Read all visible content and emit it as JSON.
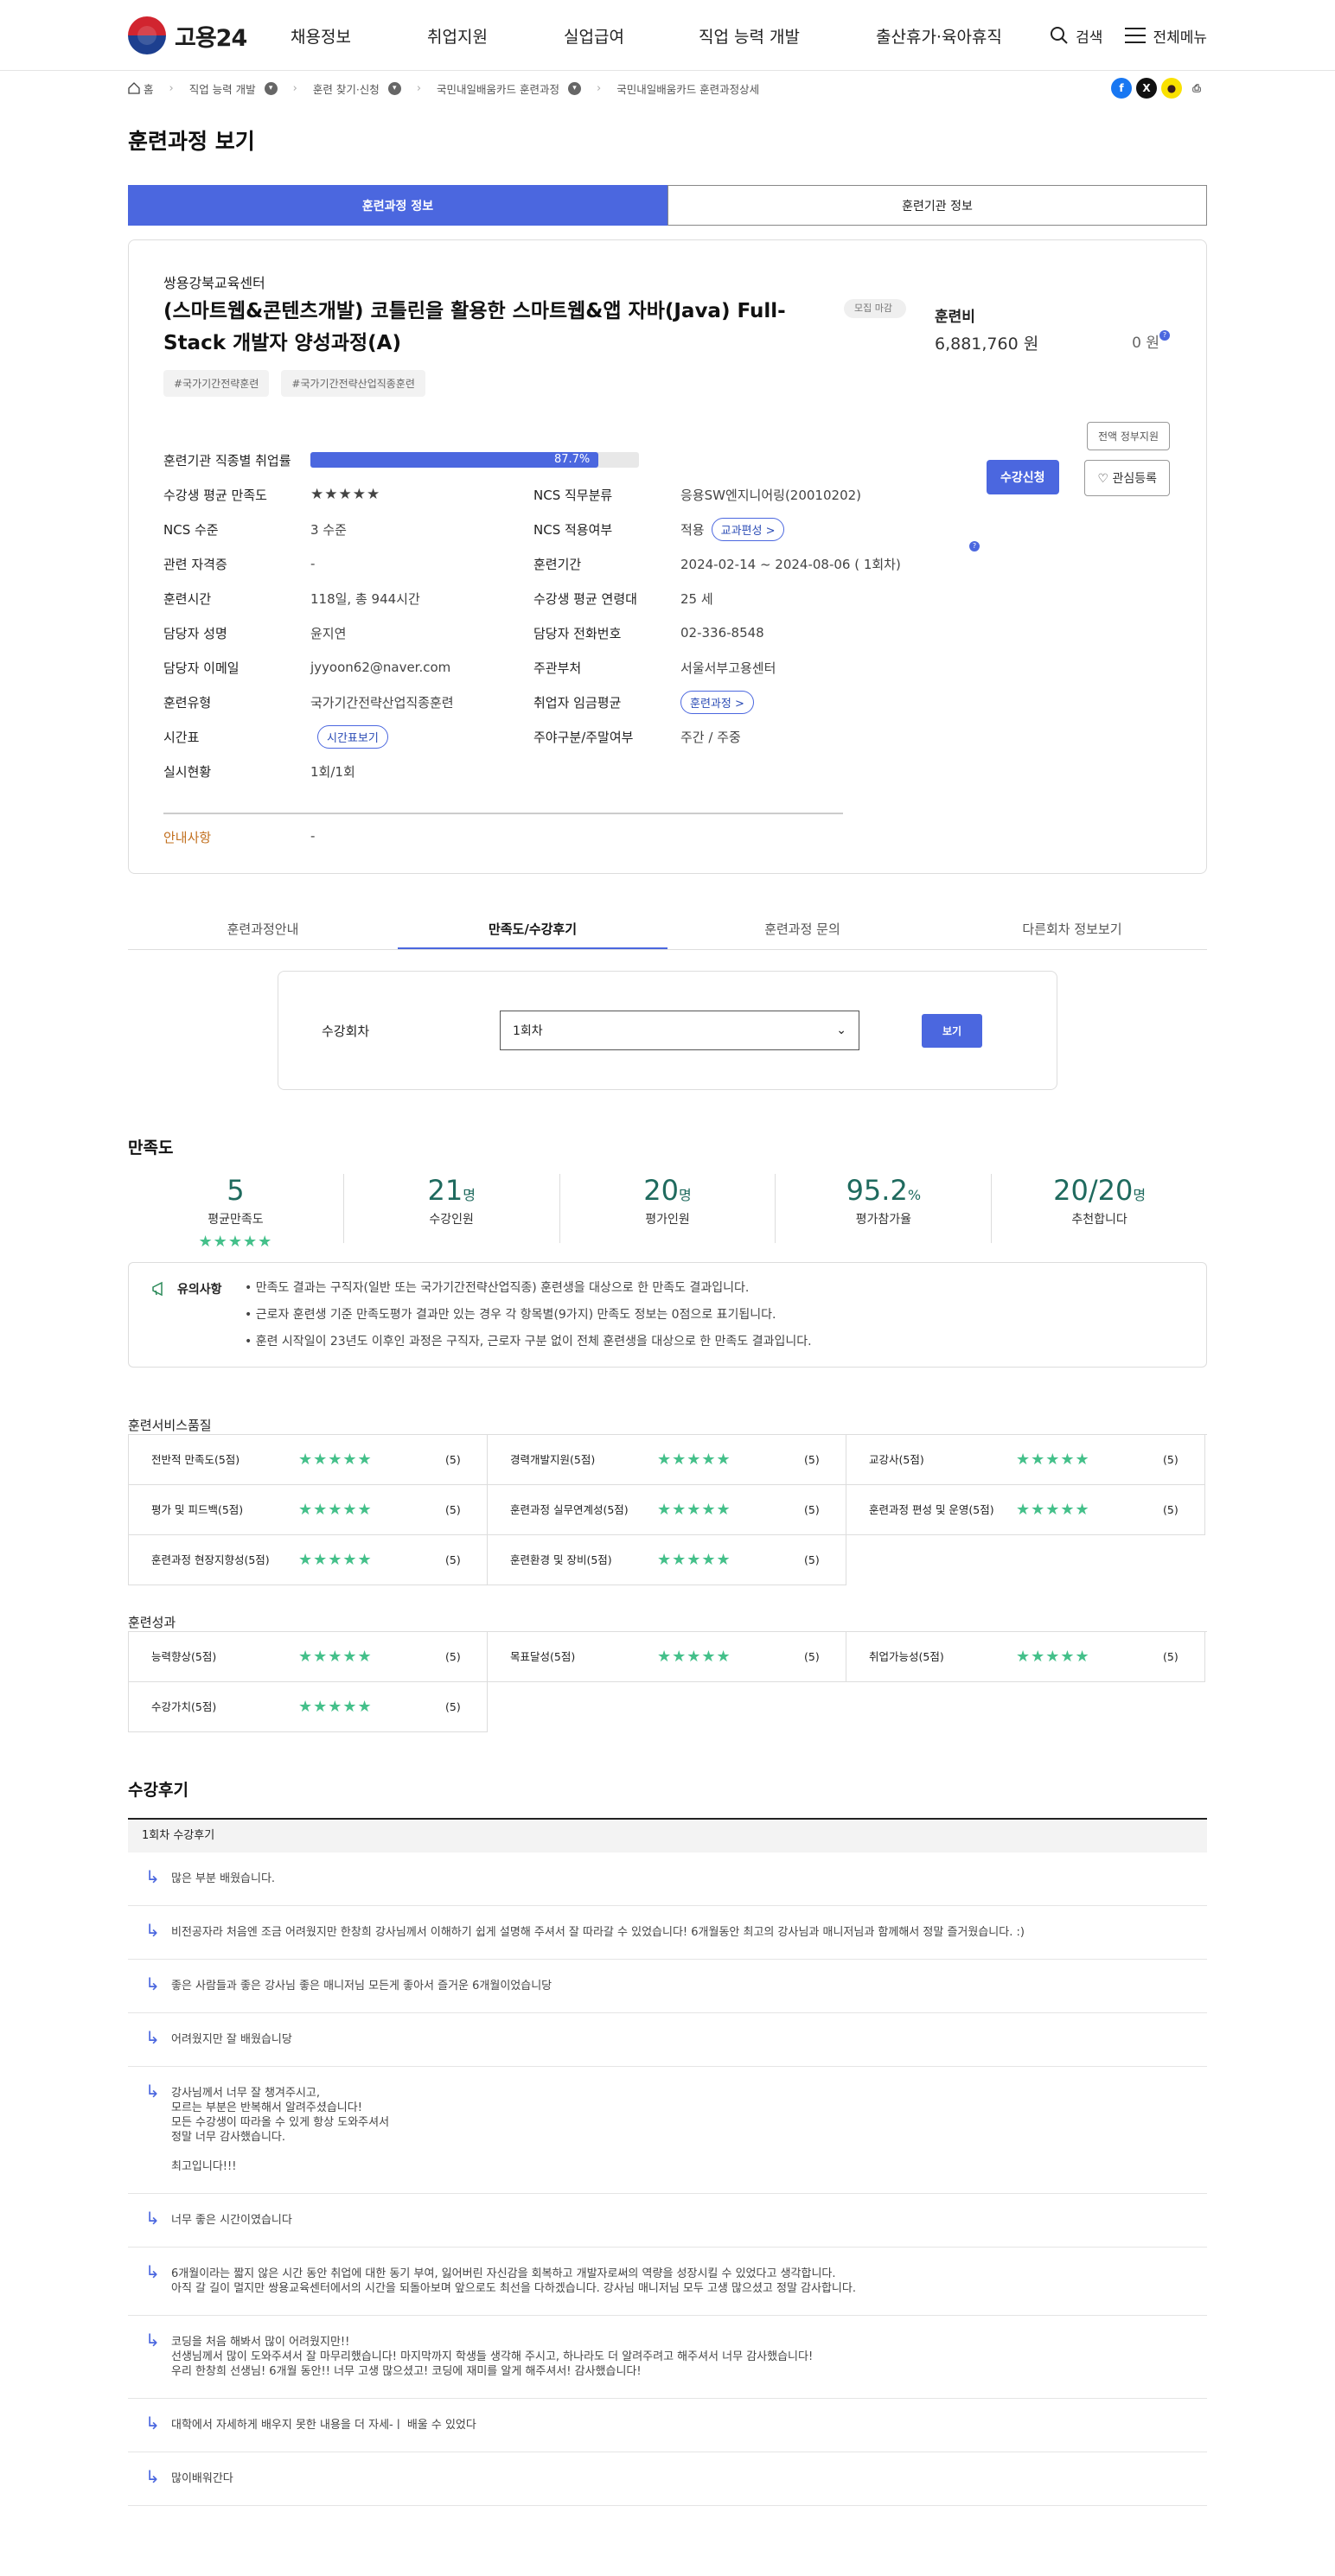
{
  "header": {
    "logo": "고용24",
    "menu": [
      "채용정보",
      "취업지원",
      "실업급여",
      "직업 능력 개발",
      "출산휴가·육아휴직"
    ],
    "search": "검색",
    "all_menu": "전체메뉴"
  },
  "breadcrumb": [
    "홈",
    "직업 능력 개발",
    "훈련 찾기·신청",
    "국민내일배움카드 훈련과정",
    "국민내일배움카드 훈련과정상세"
  ],
  "page_title": "훈련과정 보기",
  "main_tabs": [
    "훈련과정 정보",
    "훈련기관 정보"
  ],
  "course": {
    "org": "쌍용강북교육센터",
    "title": "(스마트웹&콘텐츠개발) 코틀린을 활용한 스마트웹&앱 자바(Java) Full-Stack 개발자 양성과정(A)",
    "status": "모집 마감",
    "tags": [
      "#국가기간전략훈련",
      "#국가기간전략산업직종훈련"
    ],
    "fee_label": "훈련비",
    "fee": "6,881,760 원",
    "self_pay": "0 원",
    "gov_support": "전액 정부지원",
    "apply": "수강신청",
    "favorite": "♡ 관심등록",
    "employ_label": "훈련기관 직종별 취업률",
    "employ_rate_text": "87.7%",
    "employ_rate": 87.7,
    "rows": [
      {
        "k": "수강생 평균 만족도",
        "v": "★★★★★",
        "k2": "NCS 직무분류",
        "v2": "응용SW엔지니어링(20010202)"
      },
      {
        "k": "NCS 수준",
        "v": "3 수준",
        "k2": "NCS 적용여부",
        "v2": "적용",
        "pill2": "교과편성 >"
      },
      {
        "k": "관련 자격증",
        "v": "-",
        "k2": "훈련기간",
        "v2": "2024-02-14 ~ 2024-08-06 ( 1회차)"
      },
      {
        "k": "훈련시간",
        "v": "118일, 총 944시간",
        "k2": "수강생 평균 연령대",
        "v2": "25 세"
      },
      {
        "k": "담당자 성명",
        "v": "윤지연",
        "k2": "담당자 전화번호",
        "v2": "02-336-8548"
      },
      {
        "k": "담당자 이메일",
        "v": "jyyoon62@naver.com",
        "k2": "주관부처",
        "v2": "서울서부고용센터"
      },
      {
        "k": "훈련유형",
        "v": "국가기간전략산업직종훈련",
        "k2": "취업자 임금평균",
        "v2": "",
        "pill2": "훈련과정 >"
      },
      {
        "k": "시간표",
        "v": "",
        "pill": "시간표보기",
        "k2": "주야구분/주말여부",
        "v2": "주간 / 주중"
      },
      {
        "k": "실시현황",
        "v": "1회/1회",
        "k2": "",
        "v2": ""
      }
    ],
    "notice_k": "안내사항",
    "notice_v": "-"
  },
  "sub_tabs": [
    "훈련과정안내",
    "만족도/수강후기",
    "훈련과정 문의",
    "다른회차 정보보기"
  ],
  "session": {
    "label": "수강회차",
    "value": "1회차",
    "button": "보기"
  },
  "satisfaction": {
    "title": "만족도",
    "stats": [
      {
        "n": "5",
        "u": "",
        "l": "평균만족도"
      },
      {
        "n": "21",
        "u": "명",
        "l": "수강인원"
      },
      {
        "n": "20",
        "u": "명",
        "l": "평가인원"
      },
      {
        "n": "95.2",
        "u": "%",
        "l": "평가참가율"
      },
      {
        "n": "20/20",
        "u": "명",
        "l": "추천합니다"
      }
    ],
    "stars": "★★★★★"
  },
  "caution": {
    "title": "유의사항",
    "items": [
      "만족도 결과는 구직자(일반 또는 국가기간전략산업직종) 훈련생을 대상으로 한 만족도 결과입니다.",
      "근로자 훈련생 기준 만족도평가 결과만 있는 경우 각 항목별(9가지) 만족도 정보는 0점으로 표기됩니다.",
      "훈련 시작일이 23년도 이후인 과정은 구직자, 근로자 구분 없이 전체 훈련생을 대상으로 한 만족도 결과입니다."
    ]
  },
  "quality": {
    "title": "훈련서비스품질",
    "items": [
      [
        "전반적 만족도(5점)",
        "(5)"
      ],
      [
        "경력개발지원(5점)",
        "(5)"
      ],
      [
        "교강사(5점)",
        "(5)"
      ],
      [
        "평가 및 피드백(5점)",
        "(5)"
      ],
      [
        "훈련과정 실무연계성(5점)",
        "(5)"
      ],
      [
        "훈련과정 편성 및 운영(5점)",
        "(5)"
      ],
      [
        "훈련과정 현장지향성(5점)",
        "(5)"
      ],
      [
        "훈련환경 및 장비(5점)",
        "(5)"
      ]
    ]
  },
  "outcome": {
    "title": "훈련성과",
    "items": [
      [
        "능력향상(5점)",
        "(5)"
      ],
      [
        "목표달성(5점)",
        "(5)"
      ],
      [
        "취업가능성(5점)",
        "(5)"
      ],
      [
        "수강가치(5점)",
        "(5)"
      ]
    ]
  },
  "reviews": {
    "title": "수강후기",
    "header": "1회차 수강후기",
    "items": [
      "많은 부분 배웠습니다.",
      "비전공자라 처음엔 조금 어려웠지만 한창희 강사님께서 이해하기 쉽게 설명해 주셔서 잘 따라갈 수 있었습니다! 6개월동안 최고의 강사님과 매니저님과 함께해서 정말 즐거웠습니다. :)",
      "좋은 사람들과 좋은 강사님 좋은 매니저님 모든게 좋아서 즐거운 6개월이었습니당",
      "어려웠지만 잘 배웠습니당",
      "강사님께서 너무 잘 챙겨주시고,\n모르는 부분은 반복해서 알려주셨습니다!\n모든 수강생이 따라올 수 있게 항상 도와주셔서\n정말 너무 감사했습니다.\n\n최고입니다!!!",
      "너무 좋은 시간이였습니다",
      "6개월이라는 짧지 않은 시간 동안 취업에 대한 동기 부여, 잃어버린 자신감을 회복하고 개발자로써의 역량을 성장시킬 수 있었다고 생각합니다.\n아직 갈 길이 멀지만 쌍용교육센터에서의 시간을 되돌아보며 앞으로도 최선을 다하겠습니다. 강사님 매니저님 모두 고생 많으셨고 정말 감사합니다.",
      "코딩을 처음 해봐서 많이 어려웠지만!!\n선생님께서 많이 도와주셔서 잘 마무리했습니다! 마지막까지 학생들 생각해 주시고, 하나라도 더 알려주려고 해주셔서 너무 감사했습니다!\n우리 한창희 선생님! 6개월 동안!! 너무 고생 많으셨고! 코딩에 재미를 알게 해주셔서! 감사했습니다!",
      "대학에서 자세하게 배우지 못한 내용을 더 자세-ㅣ 배울 수 있었다",
      "많이배워간다"
    ]
  }
}
